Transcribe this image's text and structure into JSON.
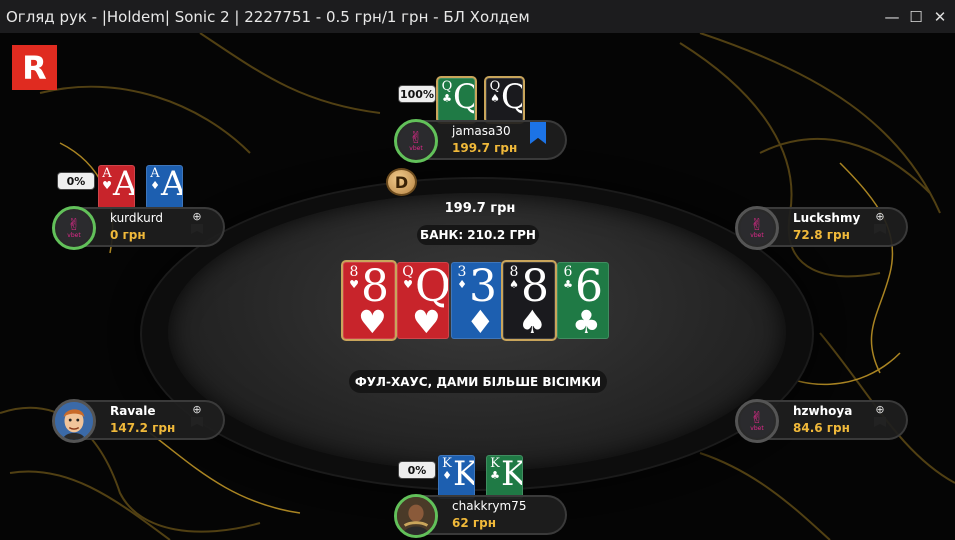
{
  "window": {
    "title": "Огляд рук - |Holdem| Sonic 2 | 2227751 - 0.5 грн/1 грн - БЛ Холдем",
    "minimize": "—",
    "maximize": "☐",
    "close": "✕"
  },
  "logo": "R",
  "dealer_button": "D",
  "pot": {
    "amount": "199.7 грн",
    "bank": "БАНК: 210.2 ГРН"
  },
  "result_text": "ФУЛ-ХАУС, ДАМИ БІЛЬШЕ ВІСІМКИ",
  "board": [
    {
      "rank": "8",
      "suit": "♥",
      "color": "red",
      "highlight": true
    },
    {
      "rank": "Q",
      "suit": "♥",
      "color": "red",
      "highlight": false
    },
    {
      "rank": "3",
      "suit": "♦",
      "color": "blue",
      "highlight": false
    },
    {
      "rank": "8",
      "suit": "♠",
      "color": "black",
      "highlight": true
    },
    {
      "rank": "6",
      "suit": "♣",
      "color": "green",
      "highlight": false
    }
  ],
  "players": [
    {
      "id": "jamasa30",
      "name": "jamasa30",
      "stack": "199.7 грн",
      "avatar": "vbet",
      "active": true,
      "bookmark": true,
      "equity": "100%",
      "cards": [
        {
          "rank": "Q",
          "suit": "♣",
          "color": "green",
          "highlight": true
        },
        {
          "rank": "Q",
          "suit": "♠",
          "color": "black",
          "highlight": true
        }
      ]
    },
    {
      "id": "kurdkurd",
      "name": "kurdkurd",
      "stack": "0 грн",
      "avatar": "vbet",
      "active": true,
      "plus": "⊕",
      "equity": "0%",
      "cards": [
        {
          "rank": "A",
          "suit": "♥",
          "color": "red",
          "highlight": false
        },
        {
          "rank": "A",
          "suit": "♦",
          "color": "blue",
          "highlight": false
        }
      ]
    },
    {
      "id": "Luckshmy",
      "name": "Luckshmy",
      "stack": "72.8 грн",
      "avatar": "vbet",
      "active": false,
      "plus": "⊕"
    },
    {
      "id": "Ravale",
      "name": "Ravale",
      "stack": "147.2 грн",
      "avatar": "face",
      "active": false,
      "plus": "⊕"
    },
    {
      "id": "hzwhoya",
      "name": "hzwhoya",
      "stack": "84.6 грн",
      "avatar": "vbet",
      "active": false,
      "plus": "⊕"
    },
    {
      "id": "chakkrym75",
      "name": "chakkrym75",
      "stack": "62 грн",
      "avatar": "photo",
      "active": true,
      "equity": "0%",
      "cards": [
        {
          "rank": "K",
          "suit": "♦",
          "color": "blue",
          "highlight": false
        },
        {
          "rank": "K",
          "suit": "♣",
          "color": "green",
          "highlight": false
        }
      ]
    }
  ],
  "avatar_brand": {
    "logo": "✌",
    "text": "vbet"
  },
  "colors": {
    "stack": "#f0b93a",
    "active_ring": "#62c15a",
    "bookmark": "#1c73e6",
    "logo_bg": "#e02b20"
  }
}
